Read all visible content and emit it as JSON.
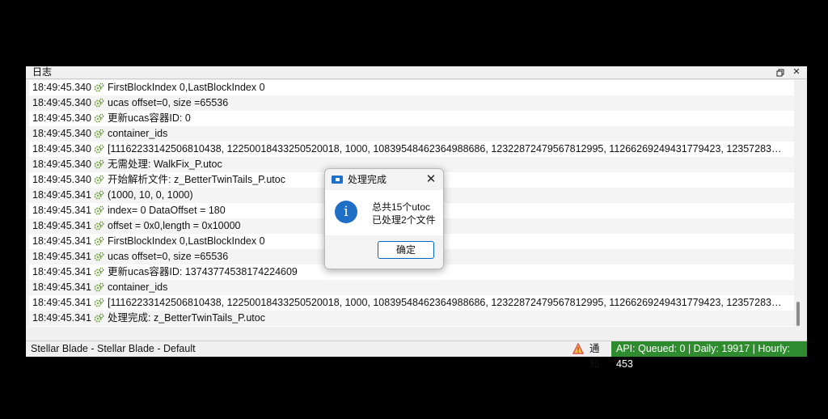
{
  "window": {
    "title": "日志",
    "restore_icon": "restore-icon",
    "close_icon": "close-icon"
  },
  "log": {
    "row_icon": "gears-icon",
    "entries": [
      {
        "time": "18:49:45.340",
        "message": "FirstBlockIndex 0,LastBlockIndex 0"
      },
      {
        "time": "18:49:45.340",
        "message": "ucas offset=0, size =65536"
      },
      {
        "time": "18:49:45.340",
        "message": "更新ucas容器ID: 0"
      },
      {
        "time": "18:49:45.340",
        "message": "container_ids"
      },
      {
        "time": "18:49:45.340",
        "message": "[1116223314250681043​8, 12250018433250520018, 1000, 10839548462364988686, 12322872479567812995, 11266269249431779423, 12357283326766..."
      },
      {
        "time": "18:49:45.340",
        "message": "无需处理: WalkFix_P.utoc"
      },
      {
        "time": "18:49:45.340",
        "message": "开始解析文件: z_BetterTwinTails_P.utoc"
      },
      {
        "time": "18:49:45.341",
        "message": "(1000, 10, 0, 1000)"
      },
      {
        "time": "18:49:45.341",
        "message": "index= 0 DataOffset = 180"
      },
      {
        "time": "18:49:45.341",
        "message": "offset = 0x0,length = 0x10000"
      },
      {
        "time": "18:49:45.341",
        "message": "FirstBlockIndex 0,LastBlockIndex 0"
      },
      {
        "time": "18:49:45.341",
        "message": "ucas offset=0, size =65536"
      },
      {
        "time": "18:49:45.341",
        "message": "更新ucas容器ID: 13743774538174224609"
      },
      {
        "time": "18:49:45.341",
        "message": "container_ids"
      },
      {
        "time": "18:49:45.341",
        "message": "[11162233142506810438, 12250018433250520018, 1000, 10839548462364988686, 12322872479567812995, 11266269249431779423, 12357283326766..."
      },
      {
        "time": "18:49:45.341",
        "message": "处理完成: z_BetterTwinTails_P.utoc"
      }
    ]
  },
  "status": {
    "profile": "Stellar Blade - Stellar Blade - Default",
    "notify_icon": "warning-icon",
    "notify_label": "通知",
    "api": "API: Queued: 0 | Daily: 19917 | Hourly: 453",
    "api_color": "#2e8b2e"
  },
  "dialog": {
    "title": "处理完成",
    "app_icon": "folder-icon",
    "close_label": "✕",
    "info_icon": "info-icon",
    "info_glyph": "i",
    "line1": "总共15个utoc",
    "line2": "已处理2个文件",
    "ok_label": "确定"
  }
}
